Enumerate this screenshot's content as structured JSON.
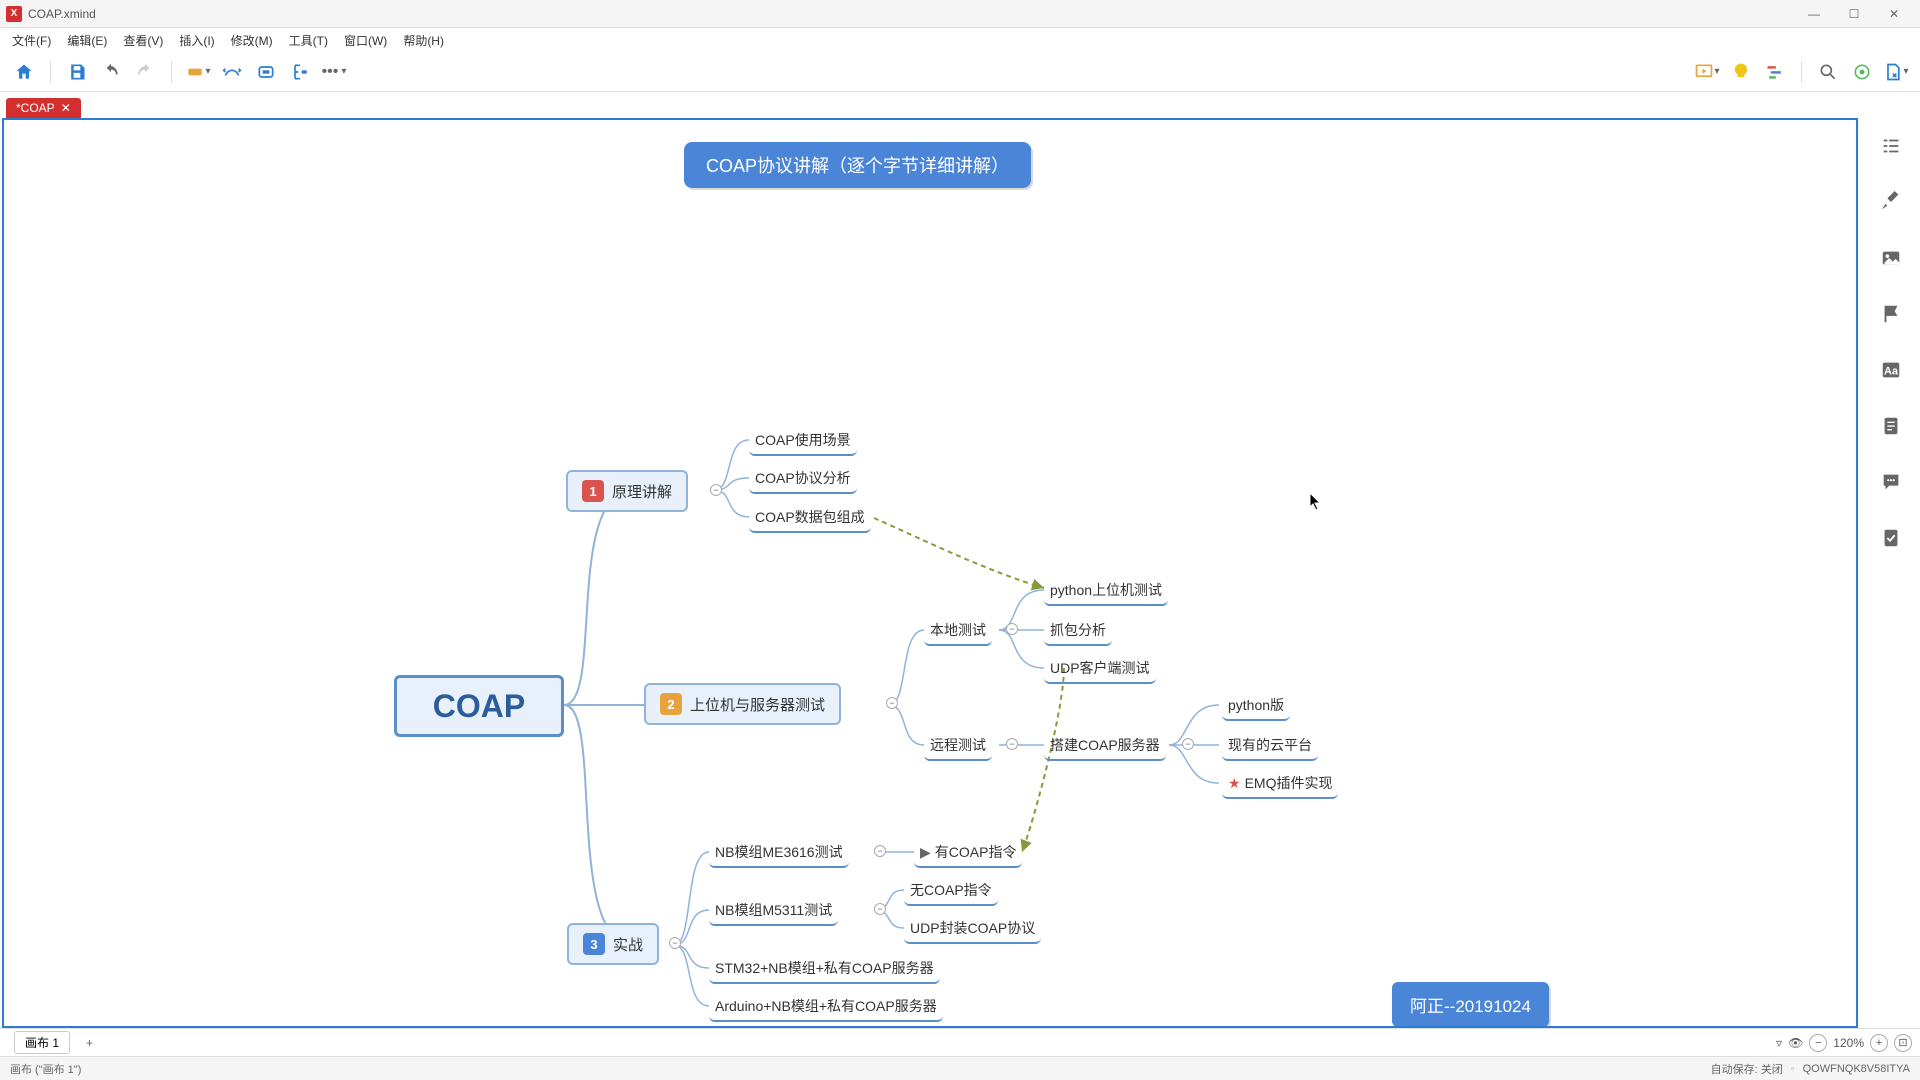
{
  "window": {
    "title": "COAP.xmind"
  },
  "menu": [
    "文件(F)",
    "编辑(E)",
    "查看(V)",
    "插入(I)",
    "修改(M)",
    "工具(T)",
    "窗口(W)",
    "帮助(H)"
  ],
  "tab": {
    "label": "*COAP"
  },
  "mindmap": {
    "title": "COAP协议讲解（逐个字节详细讲解）",
    "root": "COAP",
    "author_label": "阿正--20191024",
    "branches": [
      {
        "num": "1",
        "label": "原理讲解",
        "children": [
          {
            "label": "COAP使用场景"
          },
          {
            "label": "COAP协议分析"
          },
          {
            "label": "COAP数据包组成"
          }
        ]
      },
      {
        "num": "2",
        "label": "上位机与服务器测试",
        "children": [
          {
            "label": "本地测试",
            "children": [
              {
                "label": "python上位机测试"
              },
              {
                "label": "抓包分析"
              },
              {
                "label": "UDP客户端测试"
              }
            ]
          },
          {
            "label": "远程测试",
            "children": [
              {
                "label": "搭建COAP服务器",
                "children": [
                  {
                    "label": "python版"
                  },
                  {
                    "label": "现有的云平台"
                  },
                  {
                    "label": "EMQ插件实现",
                    "star": true
                  }
                ]
              }
            ]
          }
        ]
      },
      {
        "num": "3",
        "label": "实战",
        "children": [
          {
            "label": "NB模组ME3616测试",
            "children": [
              {
                "label": "有COAP指令",
                "flag": true
              }
            ]
          },
          {
            "label": "NB模组M5311测试",
            "children": [
              {
                "label": "无COAP指令"
              },
              {
                "label": "UDP封装COAP协议"
              }
            ]
          },
          {
            "label": "STM32+NB模组+私有COAP服务器"
          },
          {
            "label": "Arduino+NB模组+私有COAP服务器"
          }
        ]
      }
    ]
  },
  "sheet": {
    "label": "画布 1",
    "full": "画布 (\"画布 1\")"
  },
  "zoom": {
    "value": "120%"
  },
  "status": {
    "autosave": "自动保存: 关闭",
    "code": "QOWFNQK8V58ITYA"
  }
}
